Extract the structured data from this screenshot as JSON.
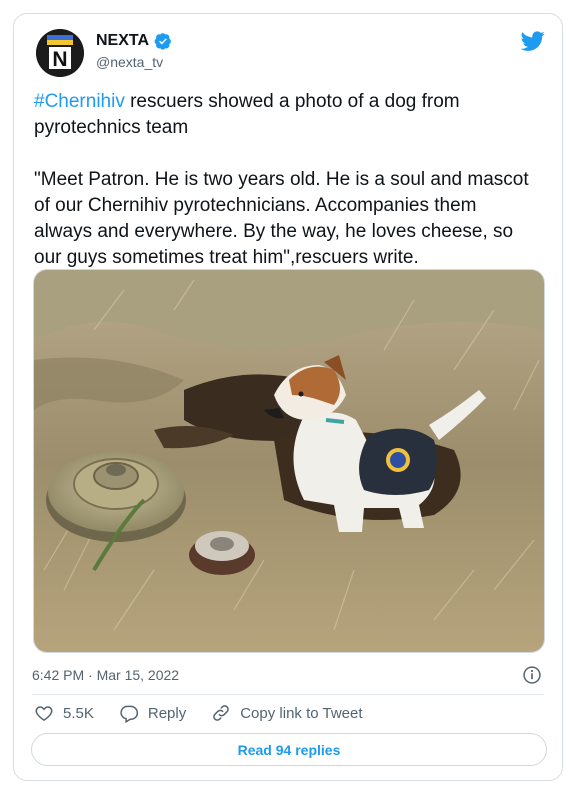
{
  "user": {
    "display_name": "NEXTA",
    "handle": "@nexta_tv",
    "avatar_icon": "nexta-logo-icon",
    "avatar_letter": "N"
  },
  "tweet": {
    "hashtag": "#Chernihiv",
    "text_after_hashtag": " rescuers showed a photo of a dog from pyrotechnics team",
    "quote": "\"Meet Patron. He is two years old. He is a soul and mascot of our Chernihiv pyrotechnicians. Accompanies them always and everywhere. By the way, he loves cheese, so our guys sometimes treat him\",rescuers write.",
    "timestamp": "6:42 PM · Mar 15, 2022"
  },
  "actions": {
    "likes": "5.5K",
    "reply_label": "Reply",
    "copy_link_label": "Copy link to Tweet"
  },
  "read_replies_label": "Read 94 replies",
  "colors": {
    "accent": "#1d9bf0",
    "text": "#0f1419",
    "muted": "#536471",
    "border": "#cfd9de"
  }
}
